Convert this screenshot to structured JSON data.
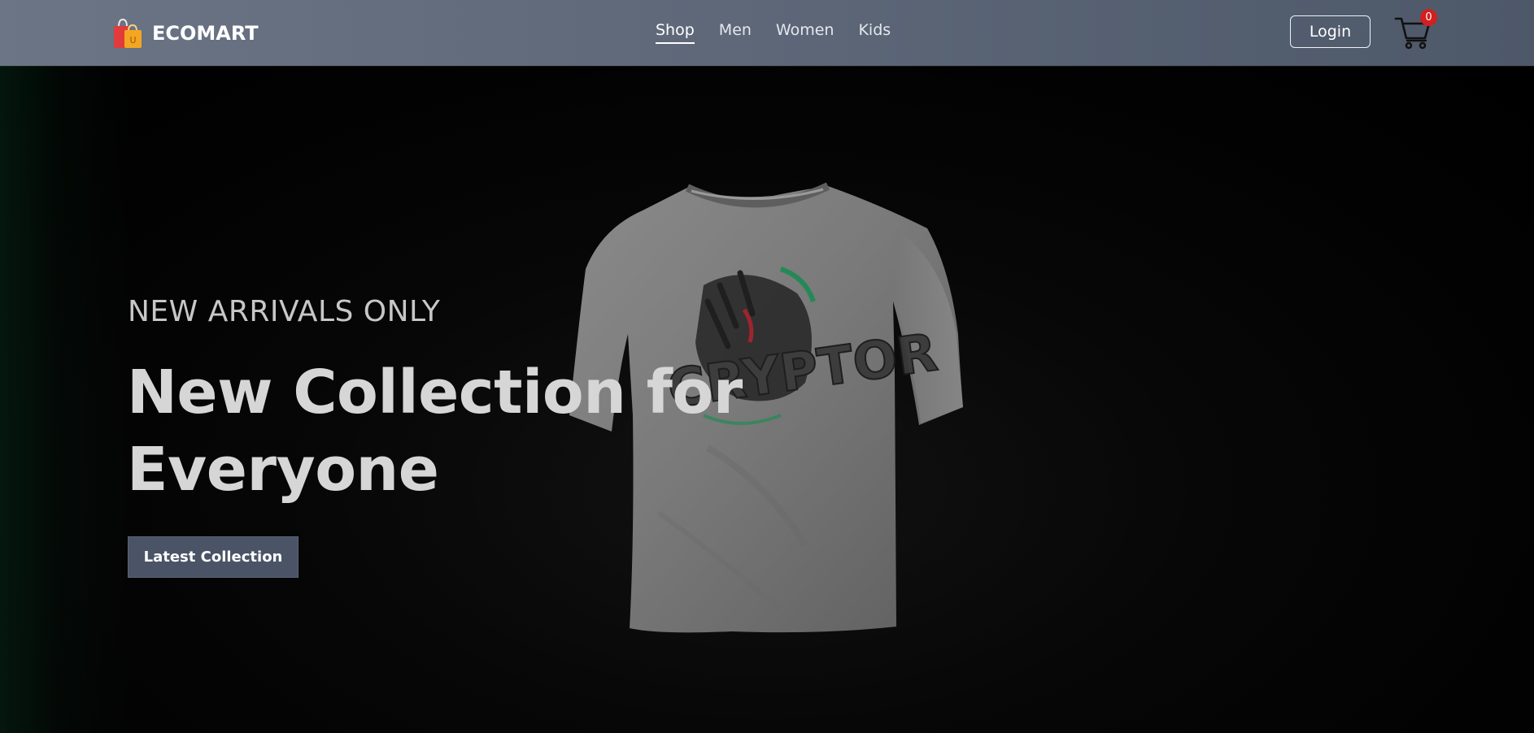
{
  "navbar": {
    "brand_name": "ECOMART",
    "links": [
      {
        "label": "Shop",
        "active": true
      },
      {
        "label": "Men",
        "active": false
      },
      {
        "label": "Women",
        "active": false
      },
      {
        "label": "Kids",
        "active": false
      }
    ],
    "login_label": "Login",
    "cart_count": "0"
  },
  "hero": {
    "eyebrow": "NEW ARRIVALS ONLY",
    "headline": "New Collection for Everyone",
    "cta_label": "Latest Collection",
    "product_graphic_text": "CRYPTOR"
  },
  "colors": {
    "navbar_bg": "#5d6778",
    "hero_bg": "#000000",
    "cta_bg": "#4a5466",
    "badge": "#d21f1f",
    "headline_text": "#d6d6d6"
  },
  "icons": [
    "shopping-bag-logo-icon",
    "cart-icon"
  ]
}
